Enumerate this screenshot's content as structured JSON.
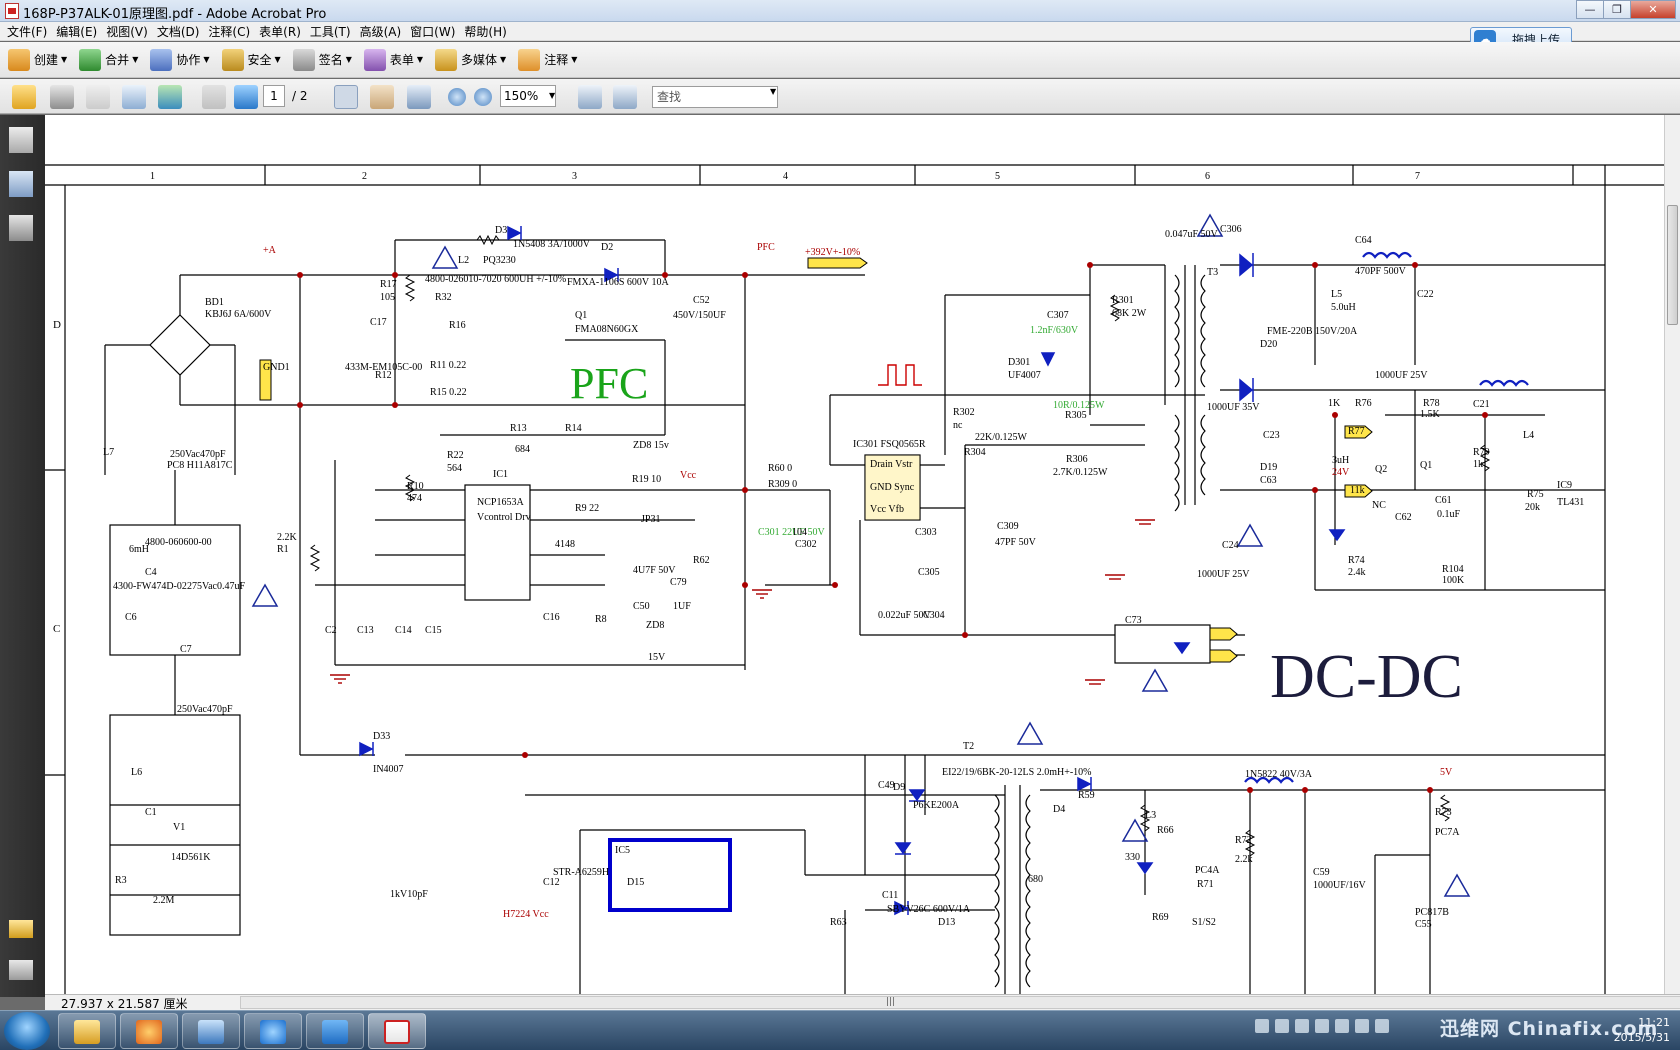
{
  "window": {
    "title": "168P-P37ALK-01原理图.pdf - Adobe Acrobat Pro",
    "min": "—",
    "max": "❐",
    "close": "✕"
  },
  "menu": [
    "文件(F)",
    "编辑(E)",
    "视图(V)",
    "文档(D)",
    "注释(C)",
    "表单(R)",
    "工具(T)",
    "高级(A)",
    "窗口(W)",
    "帮助(H)"
  ],
  "upload_label": "拖拽上传",
  "toolbar1": [
    {
      "label": "创建",
      "icon": "create-icon",
      "color": "#e9a23b"
    },
    {
      "label": "合并",
      "icon": "combine-icon",
      "color": "#3a9a3a"
    },
    {
      "label": "协作",
      "icon": "collaborate-icon",
      "color": "#5b7fc9"
    },
    {
      "label": "安全",
      "icon": "lock-icon",
      "color": "#c8982a"
    },
    {
      "label": "签名",
      "icon": "pen-icon",
      "color": "#7a7a7a"
    },
    {
      "label": "表单",
      "icon": "form-icon",
      "color": "#8a5ab0"
    },
    {
      "label": "多媒体",
      "icon": "multimedia-icon",
      "color": "#d8a52d"
    },
    {
      "label": "注释",
      "icon": "comment-icon",
      "color": "#e3a040"
    }
  ],
  "nav": {
    "page": "1",
    "total": "/ 2",
    "zoom": "150%",
    "find_placeholder": "查找"
  },
  "status": {
    "dimensions": "27.937 x 21.587 厘米"
  },
  "taskbar": {
    "watermark": "迅维网 Chinafix.com",
    "time": "11:21",
    "date": "2015/5/31"
  },
  "schematic": {
    "columns": [
      "1",
      "2",
      "3",
      "4",
      "5",
      "6",
      "7"
    ],
    "rows": [
      "D",
      "C"
    ],
    "big_labels": {
      "pfc": "PFC",
      "dcdc": "DC-DC"
    },
    "labels": [
      {
        "t": "BD1",
        "c": "#000"
      },
      {
        "t": "KBJ6J 6A/600V",
        "c": "#000"
      },
      {
        "t": "+A",
        "c": "#a00"
      },
      {
        "t": "D3",
        "c": "#000"
      },
      {
        "t": "1N5408 3A/1000V",
        "c": "#000"
      },
      {
        "t": "D2",
        "c": "#000"
      },
      {
        "t": "L2",
        "c": "#000"
      },
      {
        "t": "PQ3230",
        "c": "#000"
      },
      {
        "t": "4800-026010-7020 600UH +/-10%",
        "c": "#000"
      },
      {
        "t": "FMXA-1106S 600V 10A",
        "c": "#000"
      },
      {
        "t": "PFC",
        "c": "#a00"
      },
      {
        "t": "+392V+-10%",
        "c": "#a00"
      },
      {
        "t": "C52",
        "c": "#000"
      },
      {
        "t": "450V/150UF",
        "c": "#000"
      },
      {
        "t": "Q1",
        "c": "#000"
      },
      {
        "t": "FMA08N60GX",
        "c": "#000"
      },
      {
        "t": "R17",
        "c": "#000"
      },
      {
        "t": "105",
        "c": "#000"
      },
      {
        "t": "R32",
        "c": "#000"
      },
      {
        "t": "R16",
        "c": "#000"
      },
      {
        "t": "R12",
        "c": "#000"
      },
      {
        "t": "R11 0.22",
        "c": "#000"
      },
      {
        "t": "R15 0.22",
        "c": "#000"
      },
      {
        "t": "C17",
        "c": "#000"
      },
      {
        "t": "433M-EM105C-00",
        "c": "#000"
      },
      {
        "t": "GND1",
        "c": "#000"
      },
      {
        "t": "R13",
        "c": "#000"
      },
      {
        "t": "R14",
        "c": "#000"
      },
      {
        "t": "684",
        "c": "#000"
      },
      {
        "t": "ZD8 15v",
        "c": "#000"
      },
      {
        "t": "R22",
        "c": "#000"
      },
      {
        "t": "564",
        "c": "#000"
      },
      {
        "t": "IC1",
        "c": "#000"
      },
      {
        "t": "NCP1653A",
        "c": "#000"
      },
      {
        "t": "Vcontrol Drv",
        "c": "#000"
      },
      {
        "t": "R19 10",
        "c": "#000"
      },
      {
        "t": "Vcc",
        "c": "#a00"
      },
      {
        "t": "R9 22",
        "c": "#000"
      },
      {
        "t": "4148",
        "c": "#000"
      },
      {
        "t": "JP31",
        "c": "#000"
      },
      {
        "t": "R10",
        "c": "#000"
      },
      {
        "t": "474",
        "c": "#000"
      },
      {
        "t": "4U7F 50V",
        "c": "#000"
      },
      {
        "t": "C79",
        "c": "#000"
      },
      {
        "t": "C50",
        "c": "#000"
      },
      {
        "t": "1UF",
        "c": "#000"
      },
      {
        "t": "ZD8",
        "c": "#000"
      },
      {
        "t": "15V",
        "c": "#000"
      },
      {
        "t": "R62",
        "c": "#000"
      },
      {
        "t": "R60 0",
        "c": "#000"
      },
      {
        "t": "R309 0",
        "c": "#000"
      },
      {
        "t": "C301 22UF 50V",
        "c": "#3a3"
      },
      {
        "t": "C302",
        "c": "#000"
      },
      {
        "t": "104",
        "c": "#000"
      },
      {
        "t": "IC301 FSQ0565R",
        "c": "#000"
      },
      {
        "t": "Drain Vstr",
        "c": "#000"
      },
      {
        "t": "GND Sync",
        "c": "#000"
      },
      {
        "t": "Vcc Vfb",
        "c": "#000"
      },
      {
        "t": "R302",
        "c": "#000"
      },
      {
        "t": "nc",
        "c": "#000"
      },
      {
        "t": "C307",
        "c": "#000"
      },
      {
        "t": "1.2nF/630V",
        "c": "#3a3"
      },
      {
        "t": "R301",
        "c": "#000"
      },
      {
        "t": "68K 2W",
        "c": "#000"
      },
      {
        "t": "D301",
        "c": "#000"
      },
      {
        "t": "UF4007",
        "c": "#000"
      },
      {
        "t": "10R/0.125W",
        "c": "#3a3"
      },
      {
        "t": "R305",
        "c": "#000"
      },
      {
        "t": "22K/0.125W",
        "c": "#000"
      },
      {
        "t": "R306",
        "c": "#000"
      },
      {
        "t": "2.7K/0.125W",
        "c": "#000"
      },
      {
        "t": "R304",
        "c": "#000"
      },
      {
        "t": "C309",
        "c": "#000"
      },
      {
        "t": "47PF 50V",
        "c": "#000"
      },
      {
        "t": "C303",
        "c": "#000"
      },
      {
        "t": "C305",
        "c": "#000"
      },
      {
        "t": "0.022uF 50V",
        "c": "#000"
      },
      {
        "t": "C304",
        "c": "#000"
      },
      {
        "t": "0.047uF 50V",
        "c": "#000"
      },
      {
        "t": "C306",
        "c": "#000"
      },
      {
        "t": "T3",
        "c": "#000"
      },
      {
        "t": "FME-220B 150V/20A",
        "c": "#000"
      },
      {
        "t": "D20",
        "c": "#000"
      },
      {
        "t": "C64",
        "c": "#000"
      },
      {
        "t": "470PF 500V",
        "c": "#000"
      },
      {
        "t": "L5",
        "c": "#000"
      },
      {
        "t": "5.0uH",
        "c": "#000"
      },
      {
        "t": "C22",
        "c": "#000"
      },
      {
        "t": "1000UF 35V",
        "c": "#000"
      },
      {
        "t": "C23",
        "c": "#000"
      },
      {
        "t": "D19",
        "c": "#000"
      },
      {
        "t": "C63",
        "c": "#000"
      },
      {
        "t": "C21",
        "c": "#000"
      },
      {
        "t": "1000UF 25V",
        "c": "#000"
      },
      {
        "t": "L4",
        "c": "#000"
      },
      {
        "t": "3uH",
        "c": "#000"
      },
      {
        "t": "24V",
        "c": "#a00"
      },
      {
        "t": "R76",
        "c": "#000"
      },
      {
        "t": "1K",
        "c": "#000"
      },
      {
        "t": "R78",
        "c": "#000"
      },
      {
        "t": "1.5K",
        "c": "#000"
      },
      {
        "t": "R79",
        "c": "#000"
      },
      {
        "t": "1k",
        "c": "#000"
      },
      {
        "t": "R77",
        "c": "#000"
      },
      {
        "t": "11k",
        "c": "#000"
      },
      {
        "t": "Q2",
        "c": "#000"
      },
      {
        "t": "Q1",
        "c": "#000"
      },
      {
        "t": "NC",
        "c": "#000"
      },
      {
        "t": "C62",
        "c": "#000"
      },
      {
        "t": "C61",
        "c": "#000"
      },
      {
        "t": "0.1uF",
        "c": "#000"
      },
      {
        "t": "R75",
        "c": "#000"
      },
      {
        "t": "20k",
        "c": "#000"
      },
      {
        "t": "R104",
        "c": "#000"
      },
      {
        "t": "100K",
        "c": "#000"
      },
      {
        "t": "R74",
        "c": "#000"
      },
      {
        "t": "2.4k",
        "c": "#000"
      },
      {
        "t": "IC9",
        "c": "#000"
      },
      {
        "t": "TL431",
        "c": "#000"
      },
      {
        "t": "C24",
        "c": "#000"
      },
      {
        "t": "1000UF 25V",
        "c": "#000"
      },
      {
        "t": "C73",
        "c": "#000"
      },
      {
        "t": "250Vac470pF",
        "c": "#000"
      },
      {
        "t": "PC8 H11A817C",
        "c": "#000"
      },
      {
        "t": "L7",
        "c": "#000"
      },
      {
        "t": "6mH",
        "c": "#000"
      },
      {
        "t": "4800-060600-00",
        "c": "#000"
      },
      {
        "t": "C4",
        "c": "#000"
      },
      {
        "t": "4300-FW474D-02",
        "c": "#000"
      },
      {
        "t": "275Vac0.47uF",
        "c": "#000"
      },
      {
        "t": "C6",
        "c": "#000"
      },
      {
        "t": "C7",
        "c": "#000"
      },
      {
        "t": "250Vac470pF",
        "c": "#000"
      },
      {
        "t": "L6",
        "c": "#000"
      },
      {
        "t": "C1",
        "c": "#000"
      },
      {
        "t": "V1",
        "c": "#000"
      },
      {
        "t": "14D561K",
        "c": "#000"
      },
      {
        "t": "R3",
        "c": "#000"
      },
      {
        "t": "2.2M",
        "c": "#000"
      },
      {
        "t": "R1",
        "c": "#000"
      },
      {
        "t": "2.2K",
        "c": "#000"
      },
      {
        "t": "C2",
        "c": "#000"
      },
      {
        "t": "C13",
        "c": "#000"
      },
      {
        "t": "C14",
        "c": "#000"
      },
      {
        "t": "C15",
        "c": "#000"
      },
      {
        "t": "C16",
        "c": "#000"
      },
      {
        "t": "R8",
        "c": "#000"
      },
      {
        "t": "D33",
        "c": "#000"
      },
      {
        "t": "IN4007",
        "c": "#000"
      },
      {
        "t": "T2",
        "c": "#000"
      },
      {
        "t": "EI22/19/6BK-20-12LS 2.0mH+-10%",
        "c": "#000"
      },
      {
        "t": "C49",
        "c": "#000"
      },
      {
        "t": "D9",
        "c": "#000"
      },
      {
        "t": "P6KE200A",
        "c": "#000"
      },
      {
        "t": "D15",
        "c": "#000"
      },
      {
        "t": "IC5",
        "c": "#000"
      },
      {
        "t": "STR-A6259H",
        "c": "#000"
      },
      {
        "t": "C12",
        "c": "#000"
      },
      {
        "t": "1kV10pF",
        "c": "#000"
      },
      {
        "t": "H7224 Vcc",
        "c": "#a00"
      },
      {
        "t": "C11",
        "c": "#000"
      },
      {
        "t": "SBYV26C 600V/1A",
        "c": "#000"
      },
      {
        "t": "D13",
        "c": "#000"
      },
      {
        "t": "R63",
        "c": "#000"
      },
      {
        "t": "R59",
        "c": "#000"
      },
      {
        "t": "D4",
        "c": "#000"
      },
      {
        "t": "1N5822 40V/3A",
        "c": "#000"
      },
      {
        "t": "L3",
        "c": "#000"
      },
      {
        "t": "R66",
        "c": "#000"
      },
      {
        "t": "330",
        "c": "#000"
      },
      {
        "t": "PC4A",
        "c": "#000"
      },
      {
        "t": "R71",
        "c": "#000"
      },
      {
        "t": "R72",
        "c": "#000"
      },
      {
        "t": "2.2k",
        "c": "#000"
      },
      {
        "t": "C59",
        "c": "#000"
      },
      {
        "t": "1000UF/16V",
        "c": "#000"
      },
      {
        "t": "5V",
        "c": "#a00"
      },
      {
        "t": "R73",
        "c": "#000"
      },
      {
        "t": "PC7A",
        "c": "#000"
      },
      {
        "t": "PC817B",
        "c": "#000"
      },
      {
        "t": "C55",
        "c": "#000"
      },
      {
        "t": "R69",
        "c": "#000"
      },
      {
        "t": "S1/S2",
        "c": "#000"
      },
      {
        "t": "680",
        "c": "#000"
      }
    ]
  }
}
